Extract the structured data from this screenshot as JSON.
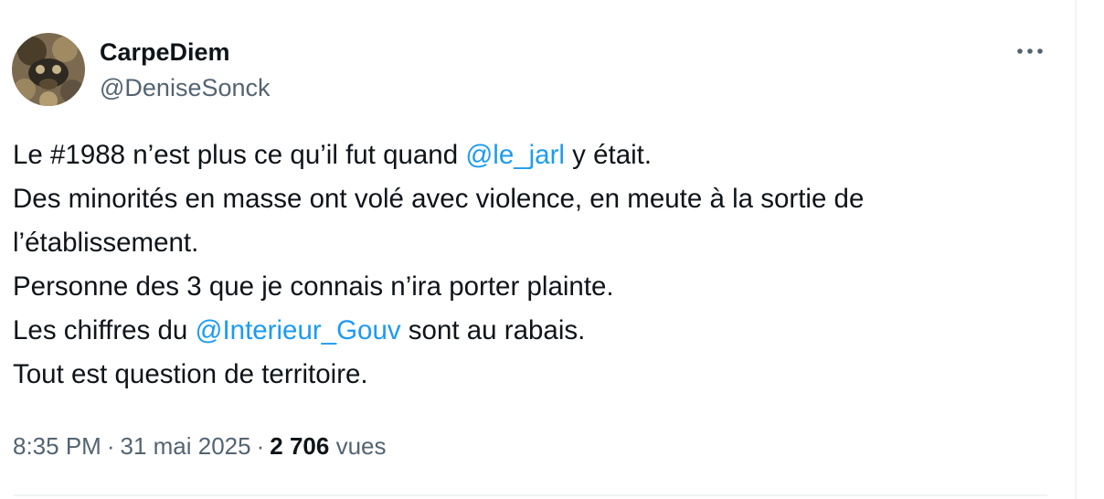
{
  "author": {
    "display_name": "CarpeDiem",
    "handle": "@DeniseSonck"
  },
  "more_icon": "more-horizontal-icon",
  "post": {
    "line1": {
      "pre": "Le #1988 n’est plus ce qu’il fut quand ",
      "mention": "@le_jarl",
      "post": " y était."
    },
    "line2": "Des minorités en masse ont volé avec violence, en meute à la sortie de",
    "line3": "l’établissement.",
    "line4": "Personne des 3 que je connais n’ira porter plainte.",
    "line5": {
      "pre": "Les chiffres du ",
      "mention": "@Interieur_Gouv",
      "post": " sont au rabais."
    },
    "line6": "Tout est question de territoire."
  },
  "meta": {
    "time": "8:35 PM",
    "separator": "·",
    "date": "31 mai 2025",
    "views_count": "2 706",
    "views_label": "vues"
  },
  "colors": {
    "text": "#0f1419",
    "secondary": "#536471",
    "link": "#1d9bf0",
    "border": "#eff3f4"
  }
}
